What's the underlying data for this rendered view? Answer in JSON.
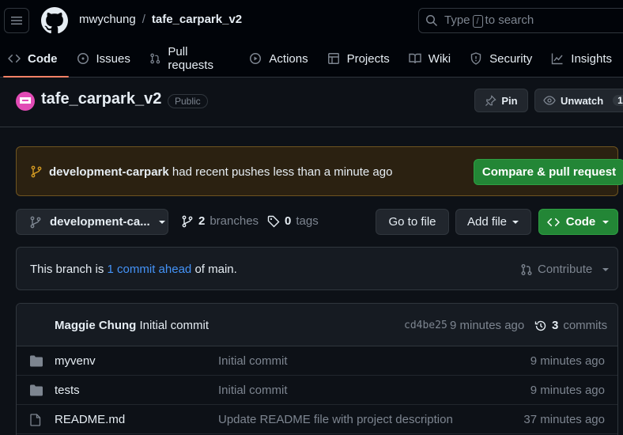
{
  "header": {
    "owner": "mwychung",
    "separator": "/",
    "repo": "tafe_carpark_v2",
    "search_prefix": "Type",
    "search_key": "/",
    "search_suffix": "to search"
  },
  "tabs": [
    {
      "label": "Code",
      "icon": "code-icon",
      "active": true
    },
    {
      "label": "Issues",
      "icon": "issue-icon"
    },
    {
      "label": "Pull requests",
      "icon": "pull-request-icon"
    },
    {
      "label": "Actions",
      "icon": "play-icon"
    },
    {
      "label": "Projects",
      "icon": "table-icon"
    },
    {
      "label": "Wiki",
      "icon": "book-icon"
    },
    {
      "label": "Security",
      "icon": "shield-icon"
    },
    {
      "label": "Insights",
      "icon": "graph-icon"
    }
  ],
  "repo_header": {
    "title": "tafe_carpark_v2",
    "visibility": "Public",
    "pin_label": "Pin",
    "watch_label": "Unwatch",
    "watch_count": "1"
  },
  "banner": {
    "branch": "development-carpark",
    "message": "had recent pushes less than a minute ago",
    "compare_label": "Compare & pull request"
  },
  "branch_bar": {
    "current_branch": "development-ca...",
    "branches_count": "2",
    "branches_label": "branches",
    "tags_count": "0",
    "tags_label": "tags",
    "goto_label": "Go to file",
    "addfile_label": "Add file",
    "code_label": "Code"
  },
  "ahead": {
    "prefix": "This branch is",
    "link": "1 commit ahead",
    "suffix": "of main.",
    "contribute_label": "Contribute"
  },
  "latest_commit": {
    "author": "Maggie Chung",
    "message": "Initial commit",
    "sha": "cd4be25",
    "time": "9 minutes ago",
    "commits_count": "3",
    "commits_label": "commits"
  },
  "files": [
    {
      "name": "myvenv",
      "type": "folder",
      "message": "Initial commit",
      "time": "9 minutes ago"
    },
    {
      "name": "tests",
      "type": "folder",
      "message": "Initial commit",
      "time": "9 minutes ago"
    },
    {
      "name": "README.md",
      "type": "file",
      "message": "Update README file with project description",
      "time": "37 minutes ago"
    }
  ],
  "colors": {
    "accent_green": "#238636",
    "link_blue": "#4493f8",
    "tab_underline": "#f78166",
    "banner_bg": "#2b2111"
  }
}
